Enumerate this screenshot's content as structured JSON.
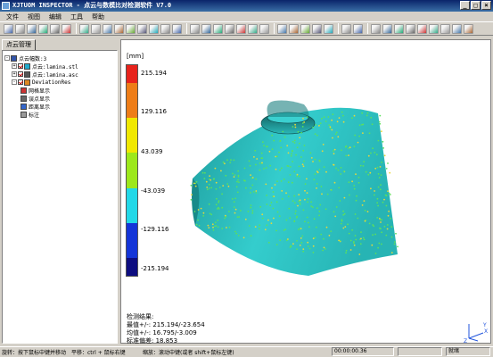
{
  "window": {
    "title": "XJTUOM INSPECTOR  - 点云与数模比对检测软件  V7.0",
    "min": "_",
    "max": "□",
    "close": "×"
  },
  "menu": [
    "文件",
    "视图",
    "编辑",
    "工具",
    "帮助"
  ],
  "left_panel": {
    "tab": "点云管理",
    "tree": [
      {
        "label": "点云幅数:3",
        "expander": "-",
        "check": false,
        "icon": "point-cloud-icon"
      },
      {
        "label": "点云:lamina.stl",
        "expander": "+",
        "check": true,
        "icon": "mesh-icon"
      },
      {
        "label": "点云:lamina.asc",
        "expander": "+",
        "check": true,
        "icon": "scatter-icon"
      },
      {
        "label": "DeviationRes",
        "expander": "-",
        "check": true,
        "icon": "deviation-icon"
      },
      {
        "label": "网格显示",
        "expander": "",
        "check": false,
        "icon": "grid-icon"
      },
      {
        "label": "误点显示",
        "expander": "",
        "check": false,
        "icon": "dots-icon"
      },
      {
        "label": "距离显示",
        "expander": "",
        "check": false,
        "icon": "distance-icon"
      },
      {
        "label": "标注",
        "expander": "",
        "check": false,
        "icon": "label-icon"
      }
    ]
  },
  "viewport": {
    "unit": "[mm]",
    "scale_colors": [
      "#e8231c",
      "#ee7d18",
      "#ee7d18",
      "#f0e800",
      "#f0e800",
      "#9de81c",
      "#9de81c",
      "#22d8e8",
      "#22d8e8",
      "#1435d8",
      "#1435d8",
      "#0d0d80"
    ],
    "scale_labels": [
      "215.194",
      "129.116",
      "43.039",
      "-43.039",
      "-129.116",
      "-215.194"
    ],
    "result": {
      "heading": "检测结果:",
      "max": "最值+/-: 215.194/-23.654",
      "mean": "均值+/-: 16.795/-3.009",
      "std": "标准偏差: 18.853"
    },
    "axis": {
      "x": "X",
      "y": "Y",
      "z": "Z"
    }
  },
  "status": {
    "rotate": "旋转：按下鼠标中键并移动",
    "pan": "平移：ctrl + 鼠标右键",
    "zoom": "缩放：滚动中键(或者 shift+鼠标左键)",
    "time": "00:00:00.36",
    "right": "就绪"
  },
  "colors": {
    "surface": "#30c6c6",
    "surface_dark": "#188a8a",
    "outlier_green": "#5ce05c",
    "outlier_yellow": "#e6d83a"
  }
}
